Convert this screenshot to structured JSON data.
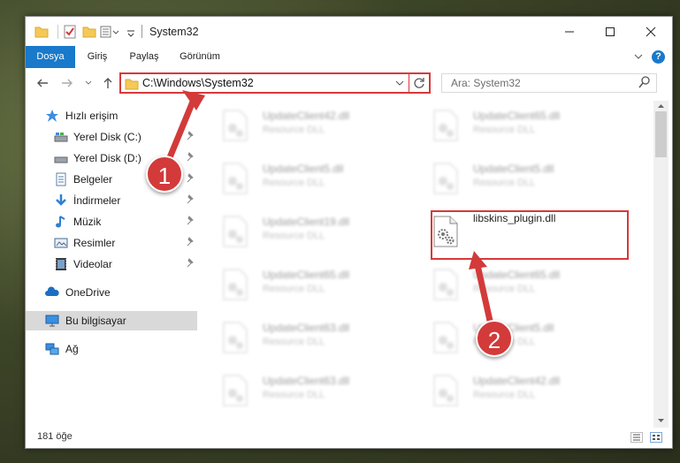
{
  "window": {
    "title": "System32"
  },
  "ribbon": {
    "tabs": [
      {
        "label": "Dosya"
      },
      {
        "label": "Giriş"
      },
      {
        "label": "Paylaş"
      },
      {
        "label": "Görünüm"
      }
    ],
    "help": "?"
  },
  "address": {
    "path": "C:\\Windows\\System32"
  },
  "search": {
    "placeholder": "Ara: System32"
  },
  "sidebar": {
    "items": [
      {
        "label": "Hızlı erişim",
        "icon": "star-icon"
      },
      {
        "label": "Yerel Disk (C:)",
        "icon": "drive-icon",
        "pinned": true
      },
      {
        "label": "Yerel Disk (D:)",
        "icon": "drive-icon",
        "pinned": true
      },
      {
        "label": "Belgeler",
        "icon": "documents-icon",
        "pinned": true
      },
      {
        "label": "İndirmeler",
        "icon": "download-icon",
        "pinned": true
      },
      {
        "label": "Müzik",
        "icon": "music-icon",
        "pinned": true
      },
      {
        "label": "Resimler",
        "icon": "pictures-icon",
        "pinned": true
      },
      {
        "label": "Videolar",
        "icon": "video-icon",
        "pinned": true
      },
      {
        "label": "OneDrive",
        "icon": "cloud-icon"
      },
      {
        "label": "Bu bilgisayar",
        "icon": "computer-icon",
        "selected": true
      },
      {
        "label": "Ağ",
        "icon": "network-icon"
      }
    ]
  },
  "files": {
    "left": [
      {
        "name": "UpdateClient42.dll",
        "type": "Resource DLL"
      },
      {
        "name": "UpdateClient5.dll",
        "type": "Resource DLL"
      },
      {
        "name": "UpdateClient19.dll",
        "type": "Resource DLL"
      },
      {
        "name": "UpdateClient65.dll",
        "type": "Resource DLL"
      },
      {
        "name": "UpdateClient63.dll",
        "type": "Resource DLL"
      },
      {
        "name": "UpdateClient63.dll",
        "type": "Resource DLL"
      }
    ],
    "right": [
      {
        "name": "UpdateClient65.dll",
        "type": "Resource DLL"
      },
      {
        "name": "UpdateClient5.dll",
        "type": "Resource DLL"
      },
      {
        "name": "libskins_plugin.dll",
        "type": ""
      },
      {
        "name": "UpdateClient65.dll",
        "type": "Resource DLL"
      },
      {
        "name": "UpdateClient5.dll",
        "type": "Resource DLL"
      },
      {
        "name": "UpdateClient42.dll",
        "type": "Resource DLL"
      }
    ]
  },
  "status": {
    "count": "181 öğe"
  },
  "annotations": {
    "step1": "1",
    "step2": "2"
  },
  "colors": {
    "accent": "#1979ca",
    "highlight": "#d6393a"
  }
}
